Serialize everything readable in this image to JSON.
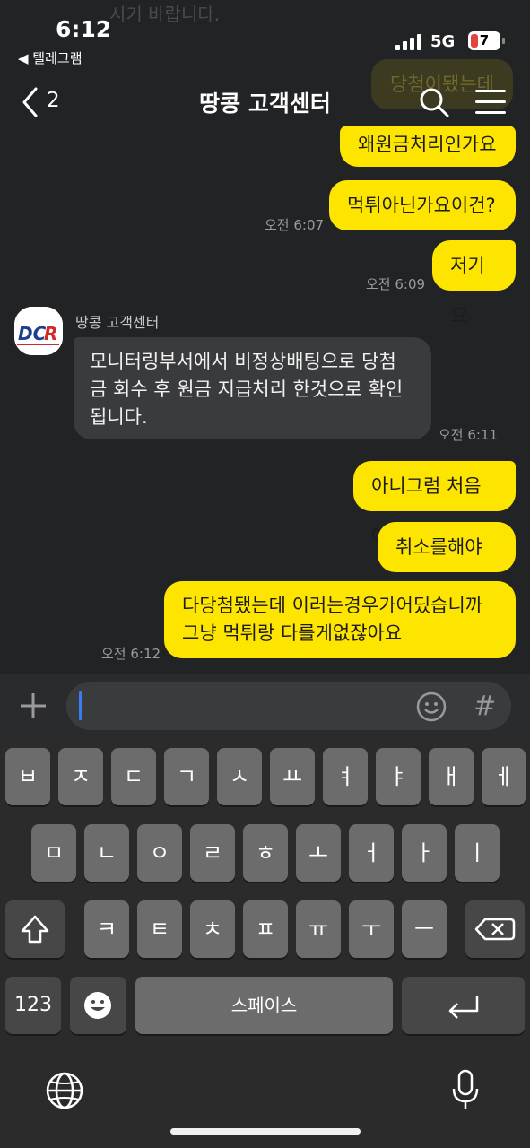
{
  "status": {
    "time": "6:12",
    "back_app": "◀ 텔레그램",
    "network": "5G",
    "battery": "7"
  },
  "ghost": {
    "top_text": "시기 바랍니다.",
    "bubble_text": "당첨이됐는데"
  },
  "header": {
    "back_count": "2",
    "title": "땅콩 고객센터"
  },
  "messages": {
    "m1": "왜원금처리인가요",
    "m2": "먹튀아닌가요이건?",
    "t2": "오전 6:07",
    "m3": "저기요",
    "t3": "오전 6:09",
    "sender": "땅콩 고객센터",
    "avatar_logo": "DCR",
    "reply_line1": "모니터링부서에서 비정상배팅으로 당첨",
    "reply_line2": "금 회수 후 원금 지급처리 한것으로 확인",
    "reply_line3": "됩니다.",
    "t_reply": "오전 6:11",
    "m4": "아니그럼 처음에",
    "m5": "취소를해야죠",
    "m6_line1": "다당첨됐는데 이러는경우가어딨습니까",
    "m6_line2": "그냥 먹튀랑 다를게없잖아요",
    "t6": "오전 6:12"
  },
  "input": {
    "hash": "#"
  },
  "keyboard": {
    "row1": [
      "ㅂ",
      "ㅈ",
      "ㄷ",
      "ㄱ",
      "ㅅ",
      "ㅛ",
      "ㅕ",
      "ㅑ",
      "ㅐ",
      "ㅔ"
    ],
    "row2": [
      "ㅁ",
      "ㄴ",
      "ㅇ",
      "ㄹ",
      "ㅎ",
      "ㅗ",
      "ㅓ",
      "ㅏ",
      "ㅣ"
    ],
    "row3": [
      "ㅋ",
      "ㅌ",
      "ㅊ",
      "ㅍ",
      "ㅠ",
      "ㅜ",
      "ㅡ"
    ],
    "numbers": "123",
    "space": "스페이스"
  },
  "colors": {
    "my_bubble": "#fee500",
    "other_bubble": "#3a3b3d",
    "background": "#222325",
    "caret": "#3a7bf7"
  },
  "icons": [
    "back-chevron-icon",
    "search-icon",
    "menu-icon",
    "plus-icon",
    "emoji-icon",
    "shift-icon",
    "backspace-icon",
    "emoji-key-icon",
    "return-icon",
    "globe-icon",
    "microphone-icon"
  ]
}
